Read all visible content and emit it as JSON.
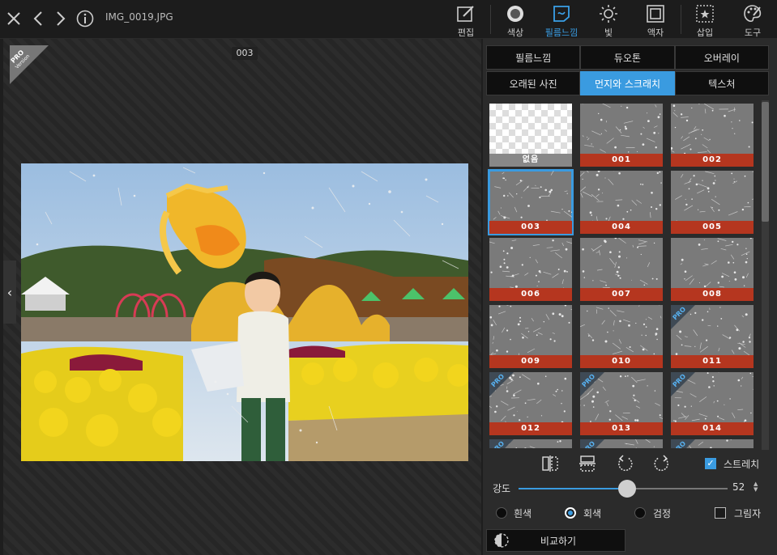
{
  "header": {
    "filename": "IMG_0019.JPG",
    "tools": [
      {
        "id": "edit",
        "label": "편집",
        "icon": "edit-icon"
      },
      {
        "id": "color",
        "label": "색상",
        "icon": "color-circle-icon"
      },
      {
        "id": "film",
        "label": "필름느낌",
        "icon": "film-icon",
        "active": true
      },
      {
        "id": "light",
        "label": "빛",
        "icon": "sun-icon"
      },
      {
        "id": "frame",
        "label": "액자",
        "icon": "frame-icon"
      },
      {
        "id": "insert",
        "label": "삽입",
        "icon": "star-box-icon"
      },
      {
        "id": "tools",
        "label": "도구",
        "icon": "palette-icon"
      }
    ]
  },
  "canvas": {
    "frame_number": "003",
    "pro_badge": {
      "line1": "PRO",
      "line2": "Version"
    }
  },
  "panel": {
    "tabs_row1": [
      {
        "label": "필름느낌"
      },
      {
        "label": "듀오톤"
      },
      {
        "label": "오버레이"
      }
    ],
    "tabs_row2": [
      {
        "label": "오래된 사진"
      },
      {
        "label": "먼지와 스크래치",
        "active": true
      },
      {
        "label": "텍스처"
      }
    ],
    "thumbnails": [
      {
        "label": "없음"
      },
      {
        "label": "001"
      },
      {
        "label": "002"
      },
      {
        "label": "003",
        "selected": true
      },
      {
        "label": "004"
      },
      {
        "label": "005"
      },
      {
        "label": "006"
      },
      {
        "label": "007"
      },
      {
        "label": "008"
      },
      {
        "label": "009"
      },
      {
        "label": "010"
      },
      {
        "label": "011",
        "pro": true
      },
      {
        "label": "012",
        "pro": true
      },
      {
        "label": "013",
        "pro": true
      },
      {
        "label": "014",
        "pro": true
      },
      {
        "label": "",
        "pro": true
      },
      {
        "label": "",
        "pro": true
      },
      {
        "label": "",
        "pro": true
      }
    ],
    "pro_text": "PRO",
    "stretch": {
      "label": "스트레치",
      "checked": true
    },
    "strength": {
      "label": "강도",
      "value": 52,
      "min": 0,
      "max": 100
    },
    "color_options": [
      {
        "label": "흰색",
        "selected": false
      },
      {
        "label": "회색",
        "selected": true
      },
      {
        "label": "검정",
        "selected": false
      }
    ],
    "shadow": {
      "label": "그림자",
      "checked": false
    },
    "compare_label": "비교하기"
  }
}
